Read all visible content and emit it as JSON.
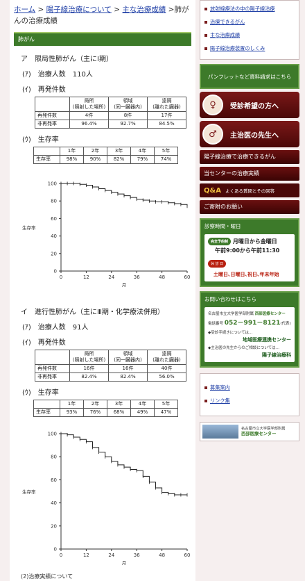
{
  "breadcrumb": {
    "home": "ホーム",
    "sep1": " > ",
    "about": "陽子線治療について",
    "sep2": " > ",
    "results": "主な治療成績",
    "current": " >肺がんの治療成績"
  },
  "section_header": "肺がん",
  "early": {
    "title": "ア　限局性肺がん（主にⅠ期）",
    "count_label": "(ｱ)　治療人数　110人",
    "recur_label": "(ｲ)　再発件数",
    "recur_table": {
      "headers": [
        "局所\n(照射した場所)",
        "領域\n(同一臓器内)",
        "遠隔\n(離れた臓器)"
      ],
      "rows": [
        {
          "label": "再発件数",
          "cells": [
            "4件",
            "8件",
            "17件"
          ]
        },
        {
          "label": "非再発率",
          "cells": [
            "96.4%",
            "92.7%",
            "84.5%"
          ]
        }
      ]
    },
    "surv_label": "(ｳ)　生存率",
    "surv_table": {
      "headers": [
        "1年",
        "2年",
        "3年",
        "4年",
        "5年"
      ],
      "row_label": "生存率",
      "cells": [
        "98%",
        "90%",
        "82%",
        "79%",
        "74%"
      ]
    }
  },
  "advanced": {
    "title": "イ　進行性肺がん（主にⅢ期・化学療法併用）",
    "count_label": "(ｱ)　治療人数　91人",
    "recur_label": "(ｲ)　再発件数",
    "recur_table": {
      "headers": [
        "局所\n(照射した場所)",
        "領域\n(同一臓器内)",
        "遠隔\n(離れた臓器)"
      ],
      "rows": [
        {
          "label": "再発件数",
          "cells": [
            "16件",
            "16件",
            "40件"
          ]
        },
        {
          "label": "非再発率",
          "cells": [
            "82.4%",
            "82.4%",
            "56.0%"
          ]
        }
      ]
    },
    "surv_label": "(ｳ)　生存率",
    "surv_table": {
      "headers": [
        "1年",
        "2年",
        "3年",
        "4年",
        "5年"
      ],
      "row_label": "生存率",
      "cells": [
        "93%",
        "76%",
        "68%",
        "49%",
        "47%"
      ]
    }
  },
  "footer_text": "(2)治療実績について",
  "chart_data": [
    {
      "type": "line",
      "title": "",
      "xlabel": "月",
      "ylabel": "生存率",
      "xlim": [
        0,
        60
      ],
      "ylim": [
        0,
        100
      ],
      "xticks": [
        0,
        12,
        24,
        36,
        48,
        60
      ],
      "yticks": [
        0,
        20,
        40,
        60,
        80,
        100
      ],
      "x": [
        0,
        3,
        6,
        9,
        12,
        15,
        18,
        21,
        24,
        27,
        30,
        33,
        36,
        39,
        42,
        45,
        48,
        51,
        54,
        57,
        60
      ],
      "y": [
        100,
        100,
        100,
        99,
        98,
        96,
        94,
        92,
        90,
        88,
        86,
        84,
        82,
        81,
        80,
        79,
        79,
        78,
        77,
        76,
        74
      ]
    },
    {
      "type": "line",
      "title": "",
      "xlabel": "月",
      "ylabel": "生存率",
      "xlim": [
        0,
        60
      ],
      "ylim": [
        0,
        100
      ],
      "xticks": [
        0,
        12,
        24,
        36,
        48,
        60
      ],
      "yticks": [
        0,
        20,
        40,
        60,
        80,
        100
      ],
      "x": [
        0,
        3,
        6,
        9,
        12,
        15,
        18,
        21,
        24,
        27,
        30,
        33,
        36,
        39,
        42,
        45,
        48,
        51,
        54,
        57,
        60
      ],
      "y": [
        100,
        99,
        97,
        95,
        93,
        88,
        84,
        80,
        76,
        73,
        71,
        69,
        68,
        63,
        58,
        53,
        49,
        48,
        47,
        47,
        47
      ]
    }
  ],
  "side": {
    "links": [
      "放射線療法の中の陽子線治療",
      "治療できるがん",
      "主な治療成績",
      "陽子線治療装置のしくみ"
    ],
    "pamphlet": "パンフレットなど資料請求はこちら",
    "patient_btn": "受診希望の方へ",
    "doctor_btn": "主治医の先生へ",
    "red_buttons": [
      "陽子線治療で治療できるがん",
      "当センターの治療実績"
    ],
    "qa_mark": "Q&A",
    "qa_text": "よくある質問とその回答",
    "donation": "ご寄附のお願い",
    "hours": {
      "title": "診察時間・曜日",
      "tag_appt": "完全予約制",
      "days": "月曜日から金曜日",
      "time": "午前9:00から午前11:30",
      "tag_closed": "休 診 日",
      "closed": "土曜日､日曜日､祝日､年末年始"
    },
    "contact": {
      "title": "お問い合わせはこちら",
      "org_small": "名古屋市立大学医学部附属",
      "org": "西部医療センター",
      "tel_label": "電話番号",
      "tel": "052－991－8121",
      "tel_note": "(代表)",
      "line1": "◆受診手続きについては…",
      "line1_dest": "地域医療連携センター",
      "line2": "◆主治医の先生からのご相談については…",
      "line2_dest": "陽子線治療科"
    },
    "bottom_links": [
      "募集案内",
      "リンク集"
    ],
    "logo_small": "名古屋市立大学医学部附属",
    "logo_main": "西部医療センター"
  }
}
